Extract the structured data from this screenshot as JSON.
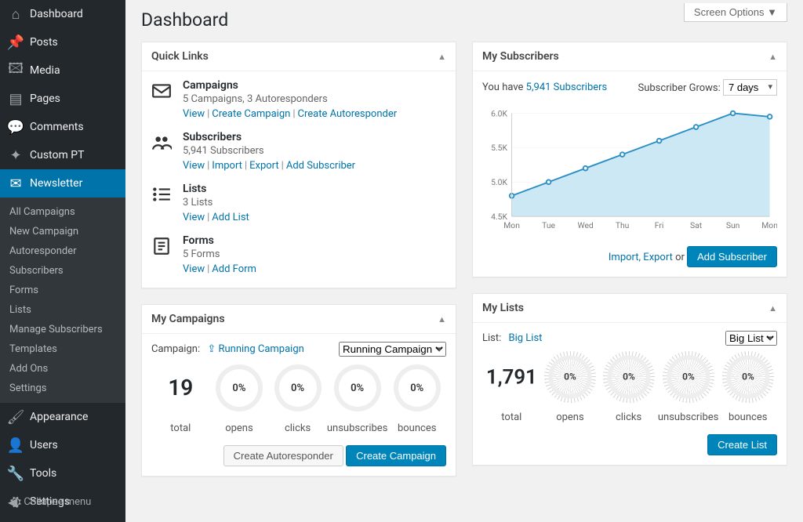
{
  "page": {
    "title": "Dashboard",
    "screen_options": "Screen Options ▼"
  },
  "sidebar": {
    "items": [
      {
        "label": "Dashboard",
        "icon": "⌂"
      },
      {
        "label": "Posts",
        "icon": "📌"
      },
      {
        "label": "Media",
        "icon": "🖾"
      },
      {
        "label": "Pages",
        "icon": "▤"
      },
      {
        "label": "Comments",
        "icon": "💬"
      },
      {
        "label": "Custom PT",
        "icon": "✦"
      },
      {
        "label": "Newsletter",
        "icon": "✉",
        "current": true
      },
      {
        "label": "Appearance",
        "icon": "🖌"
      },
      {
        "label": "Users",
        "icon": "👤"
      },
      {
        "label": "Tools",
        "icon": "🔧"
      },
      {
        "label": "Settings",
        "icon": "⛭"
      }
    ],
    "submenu": [
      "All Campaigns",
      "New Campaign",
      "Autoresponder",
      "Subscribers",
      "Forms",
      "Lists",
      "Manage Subscribers",
      "Templates",
      "Add Ons",
      "Settings"
    ],
    "collapse": "Collapse menu"
  },
  "quicklinks": {
    "title": "Quick Links",
    "rows": [
      {
        "icon": "envelope",
        "title": "Campaigns",
        "sub": "5 Campaigns, 3 Autoresponders",
        "links": [
          "View",
          "Create Campaign",
          "Create Autoresponder"
        ]
      },
      {
        "icon": "users",
        "title": "Subscribers",
        "sub": "5,941 Subscribers",
        "links": [
          "View",
          "Import",
          "Export",
          "Add Subscriber"
        ]
      },
      {
        "icon": "list",
        "title": "Lists",
        "sub": "3 Lists",
        "links": [
          "View",
          "Add List"
        ]
      },
      {
        "icon": "form",
        "title": "Forms",
        "sub": "5 Forms",
        "links": [
          "View",
          "Add Form"
        ]
      }
    ]
  },
  "mycampaigns": {
    "title": "My Campaigns",
    "label": "Campaign:",
    "selected": "Running Campaign",
    "select_option": "Running Campaign",
    "total": "19",
    "metrics": [
      {
        "value": "0%",
        "label": "opens"
      },
      {
        "value": "0%",
        "label": "clicks"
      },
      {
        "value": "0%",
        "label": "unsubscribes"
      },
      {
        "value": "0%",
        "label": "bounces"
      }
    ],
    "total_label": "total",
    "btn_auto": "Create Autoresponder",
    "btn_campaign": "Create Campaign"
  },
  "mysubs": {
    "title": "My Subscribers",
    "you_have": "You have ",
    "count_link": "5,941 Subscribers",
    "grows_label": "Subscriber Grows:",
    "grows_value": "7 days",
    "import_export": "Import, Export",
    "or": " or ",
    "add_btn": "Add Subscriber"
  },
  "mylists": {
    "title": "My Lists",
    "label": "List:",
    "selected": "Big List",
    "select_option": "Big List",
    "total": "1,791",
    "metrics": [
      {
        "value": "0%",
        "label": "opens"
      },
      {
        "value": "0%",
        "label": "clicks"
      },
      {
        "value": "0%",
        "label": "unsubscribes"
      },
      {
        "value": "0%",
        "label": "bounces"
      }
    ],
    "total_label": "total",
    "btn": "Create List"
  },
  "chart_data": {
    "type": "line",
    "title": "",
    "xlabel": "",
    "ylabel": "",
    "categories": [
      "Mon",
      "Tue",
      "Wed",
      "Thu",
      "Fri",
      "Sat",
      "Sun",
      "Mon"
    ],
    "values": [
      4800,
      5000,
      5200,
      5400,
      5600,
      5800,
      6000,
      5950
    ],
    "ylim": [
      4500,
      6000
    ],
    "yticks": [
      "4.5K",
      "5.0K",
      "5.5K",
      "6.0K"
    ]
  }
}
